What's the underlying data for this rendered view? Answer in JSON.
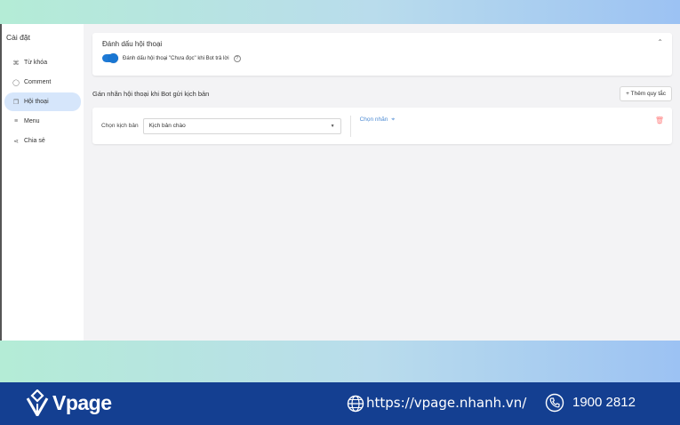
{
  "sidebar": {
    "title": "Cài đặt",
    "items": [
      {
        "label": "Từ khóa",
        "icon": "keyword-icon"
      },
      {
        "label": "Comment",
        "icon": "comment-icon"
      },
      {
        "label": "Hội thoại",
        "icon": "conversation-icon",
        "active": true
      },
      {
        "label": "Menu",
        "icon": "menu-icon"
      },
      {
        "label": "Chia sẻ",
        "icon": "share-icon"
      }
    ]
  },
  "mark_section": {
    "title": "Đánh dấu hội thoại",
    "toggle_label": "Đánh dấu hội thoại \"Chưa đọc\" khi Bot trả lời",
    "toggle_on": true
  },
  "label_section": {
    "title": "Gán nhãn hội thoại khi Bot gửi kịch bản",
    "add_button": "+ Thêm quy tắc",
    "rule": {
      "script_label": "Chọn kịch bản",
      "script_value": "Kịch bản chào",
      "label_picker": "Chọn nhãn"
    }
  },
  "footer": {
    "brand": "Vpage",
    "website": "https://vpage.nhanh.vn/",
    "phone": "1900 2812"
  },
  "colors": {
    "accent": "#1976d2",
    "active_nav": "#d6e6fb",
    "footer_bg": "#143f91",
    "delete": "#ff8585"
  }
}
